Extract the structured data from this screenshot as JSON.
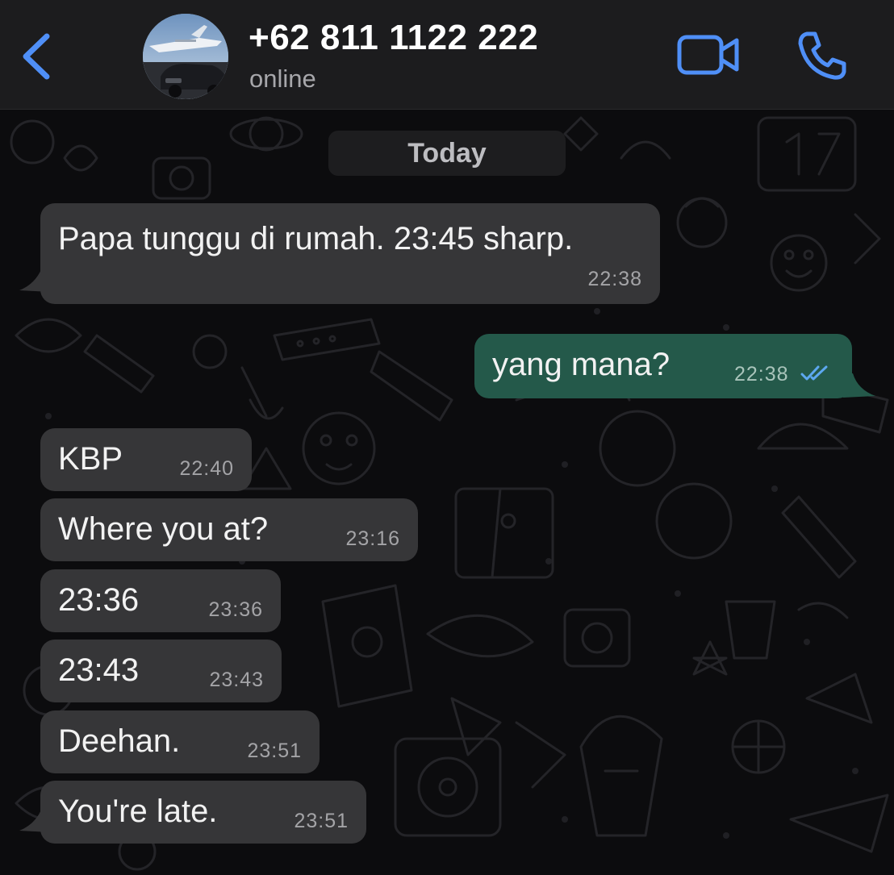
{
  "header": {
    "back_icon": "chevron-left-icon",
    "contact_name": "+62 811 1122 222",
    "status": "online",
    "video_icon": "video-camera-icon",
    "phone_icon": "phone-icon",
    "accent_color": "#4f8ff7"
  },
  "chat": {
    "date_separator": "Today",
    "messages": [
      {
        "direction": "in",
        "text": "Papa tunggu di rumah. 23:45 sharp.",
        "time": "22:38"
      },
      {
        "direction": "out",
        "text": "yang mana?",
        "time": "22:38",
        "status_icon": "double-check-read-icon"
      },
      {
        "direction": "in",
        "text": "KBP",
        "time": "22:40"
      },
      {
        "direction": "in",
        "text": "Where you at?",
        "time": "23:16"
      },
      {
        "direction": "in",
        "text": "23:36",
        "time": "23:36"
      },
      {
        "direction": "in",
        "text": "23:43",
        "time": "23:43"
      },
      {
        "direction": "in",
        "text": "Deehan.",
        "time": "23:51"
      },
      {
        "direction": "in",
        "text": "You're late.",
        "time": "23:51"
      }
    ],
    "colors": {
      "incoming_bubble": "#363638",
      "outgoing_bubble": "#24594a",
      "read_tick": "#5da8f0"
    }
  }
}
